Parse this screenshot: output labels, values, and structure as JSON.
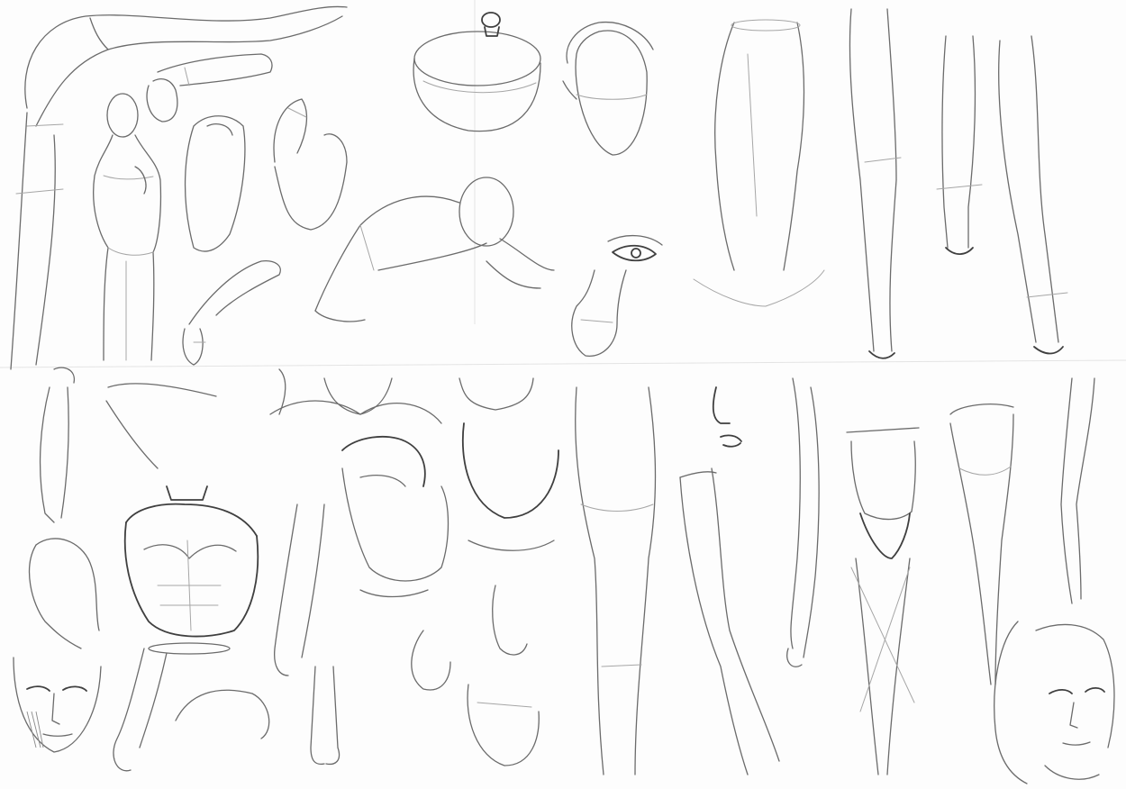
{
  "sheet": {
    "paper_color": "#fdfdfd",
    "pencil_color": "#6b6b6b",
    "dark_pencil_color": "#3f3f3f"
  }
}
